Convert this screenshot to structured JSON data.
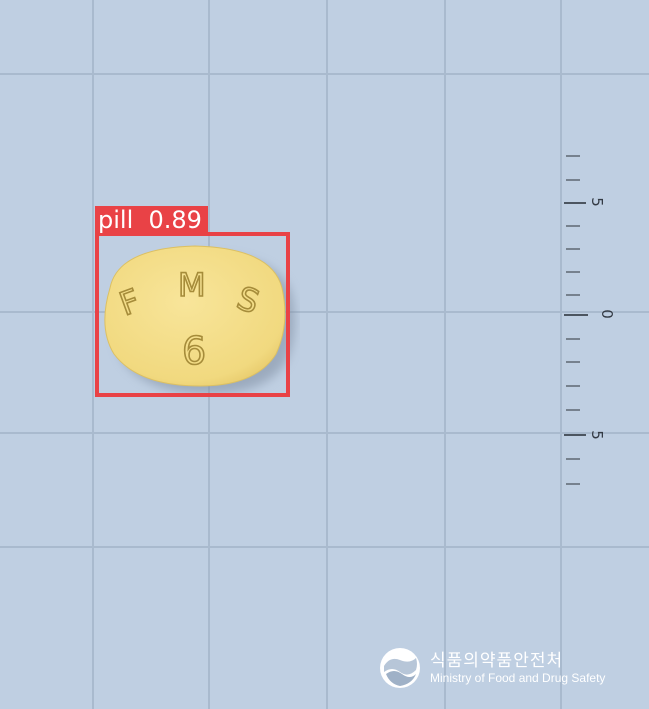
{
  "image": {
    "background_color": "#bfcfe2",
    "grid_color": "#a9bace"
  },
  "detection": {
    "label": "pill  0.89",
    "class_name": "pill",
    "confidence": 0.89,
    "box_color": "#e94246"
  },
  "pill": {
    "color": "#f4de8c",
    "imprint_top": "F M S",
    "imprint_bottom": "6"
  },
  "ruler": {
    "labels": [
      "5",
      "0",
      "5"
    ]
  },
  "watermark": {
    "name_ko": "식품의약품안전처",
    "name_en": "Ministry of Food and Drug Safety",
    "emblem_icon": "taegeuk-emblem-icon"
  }
}
